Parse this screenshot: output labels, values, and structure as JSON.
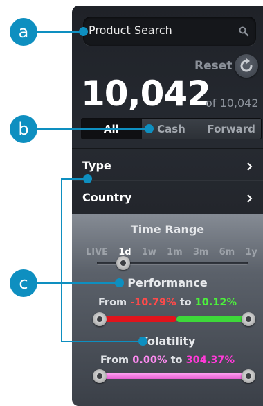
{
  "search": {
    "placeholder": "Product Search"
  },
  "reset": {
    "label": "Reset"
  },
  "results": {
    "count": "10,042",
    "total": "of 10,042"
  },
  "product_types": [
    {
      "label": "All",
      "selected": true
    },
    {
      "label": "Cash",
      "selected": false
    },
    {
      "label": "Forward",
      "selected": false
    }
  ],
  "rows": [
    {
      "label": "Type"
    },
    {
      "label": "Country"
    }
  ],
  "time_range": {
    "title": "Time Range",
    "options": [
      "LIVE",
      "1d",
      "1w",
      "1m",
      "3m",
      "6m",
      "1y"
    ],
    "selected": "1d"
  },
  "performance": {
    "title": "Performance",
    "from_word": "From",
    "to_word": "to",
    "from_value": "-10.79%",
    "to_value": "10.12%",
    "negative_color": "#e0141c",
    "positive_color": "#3ed83a"
  },
  "volatility": {
    "title": "Volatility",
    "from_word": "From",
    "to_word": "to",
    "from_value": "0.00%",
    "to_value": "304.37%",
    "bar_color": "#f06ad8"
  },
  "callouts": {
    "a": "a",
    "b": "b",
    "c": "c"
  },
  "accent_color": "#0e8fc0"
}
